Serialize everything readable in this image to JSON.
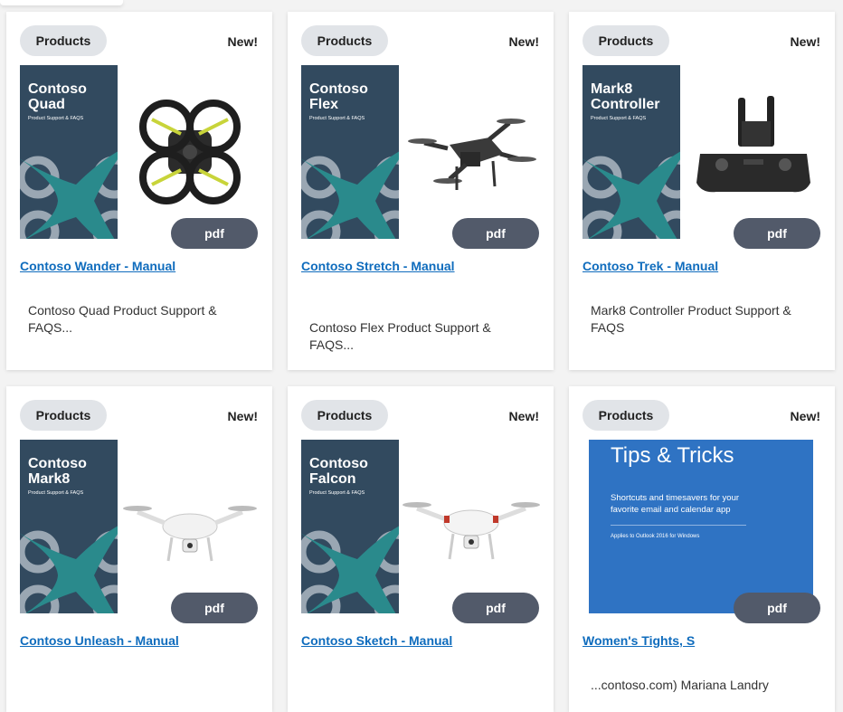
{
  "cards": [
    {
      "tag": "Products",
      "badge": "New!",
      "cover_title": "Contoso\nQuad",
      "cover_sub": "Product Support & FAQS",
      "product": "quad-drone",
      "file_type": "pdf",
      "title": "Contoso Wander - Manual",
      "description": "Contoso Quad Product Support & FAQS..."
    },
    {
      "tag": "Products",
      "badge": "New!",
      "cover_title": "Contoso\nFlex",
      "cover_sub": "Product Support & FAQS",
      "product": "mini-drone",
      "file_type": "pdf",
      "title": "Contoso Stretch - Manual",
      "description": "Contoso Flex Product Support & FAQS..."
    },
    {
      "tag": "Products",
      "badge": "New!",
      "cover_title": "Mark8\nController",
      "cover_sub": "Product Support & FAQS",
      "product": "controller",
      "file_type": "pdf",
      "title": "Contoso Trek - Manual",
      "description": "Mark8 Controller Product Support & FAQS"
    },
    {
      "tag": "Products",
      "badge": "New!",
      "cover_title": "Contoso\nMark8",
      "cover_sub": "Product Support & FAQS",
      "product": "white-drone",
      "file_type": "pdf",
      "title": "Contoso Unleash - Manual",
      "description": ""
    },
    {
      "tag": "Products",
      "badge": "New!",
      "cover_title": "Contoso\nFalcon",
      "cover_sub": "Product Support & FAQS",
      "product": "white-drone-red",
      "file_type": "pdf",
      "title": "Contoso Sketch - Manual",
      "description": ""
    },
    {
      "tag": "Products",
      "badge": "New!",
      "tips_title": "Tips & Tricks",
      "tips_body": "Shortcuts and timesavers for your favorite email and calendar app",
      "tips_note": "Applies to Outlook 2016 for Windows",
      "file_type": "pdf",
      "title": "Women's Tights, S",
      "description": "...contoso.com) Mariana Landry"
    }
  ],
  "colors": {
    "cover": "#324a5f",
    "teal": "#2a8a8c",
    "link": "#0f6cbd",
    "pdf_pill": "#525a6a",
    "chip": "#e1e4e8",
    "tips": "#2f73c3"
  }
}
